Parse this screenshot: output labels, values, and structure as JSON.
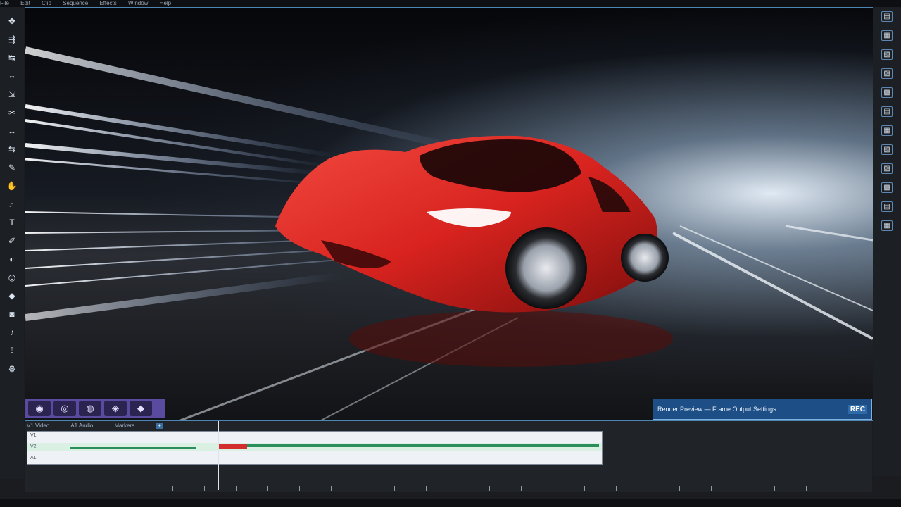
{
  "menubar": {
    "items": [
      "File",
      "Edit",
      "Clip",
      "Sequence",
      "Effects",
      "Window",
      "Help"
    ]
  },
  "left_toolbar": {
    "tools": [
      {
        "name": "selection-tool-icon",
        "glyph": "✥"
      },
      {
        "name": "track-select-icon",
        "glyph": "⇶"
      },
      {
        "name": "ripple-edit-icon",
        "glyph": "↹"
      },
      {
        "name": "rolling-edit-icon",
        "glyph": "⇔"
      },
      {
        "name": "rate-stretch-icon",
        "glyph": "⇲"
      },
      {
        "name": "razor-icon",
        "glyph": "✂"
      },
      {
        "name": "slip-icon",
        "glyph": "↔"
      },
      {
        "name": "slide-icon",
        "glyph": "⇆"
      },
      {
        "name": "pen-icon",
        "glyph": "✎"
      },
      {
        "name": "hand-icon",
        "glyph": "✋"
      },
      {
        "name": "zoom-icon",
        "glyph": "⌕"
      },
      {
        "name": "type-icon",
        "glyph": "T"
      },
      {
        "name": "brush-icon",
        "glyph": "✐"
      },
      {
        "name": "color-icon",
        "glyph": "◐"
      },
      {
        "name": "mask-icon",
        "glyph": "◎"
      },
      {
        "name": "marker-icon",
        "glyph": "◆"
      },
      {
        "name": "camera-icon",
        "glyph": "◙"
      },
      {
        "name": "audio-icon",
        "glyph": "♪"
      },
      {
        "name": "export-icon",
        "glyph": "⇪"
      },
      {
        "name": "settings-icon",
        "glyph": "⚙"
      }
    ]
  },
  "right_toolbar": {
    "buttons": [
      "▤",
      "▦",
      "▧",
      "▨",
      "▩",
      "▤",
      "▦",
      "▧",
      "▨",
      "▩",
      "▤",
      "▦"
    ]
  },
  "viewer": {
    "thumbnails": [
      "◉",
      "◎",
      "◍",
      "◈",
      "◆"
    ],
    "caption_text": "Render Preview — Frame Output Settings",
    "caption_code": "REC"
  },
  "timeline": {
    "labels": [
      "V1 Video",
      "A1 Audio",
      "Markers"
    ],
    "button_label": "+",
    "tracks": [
      "V1",
      "V2",
      "A1"
    ]
  },
  "colors": {
    "accent": "#4d86b3",
    "clip_red": "#d32d2d",
    "clip_green": "#2a8f5a",
    "car_red": "#d8231f"
  }
}
